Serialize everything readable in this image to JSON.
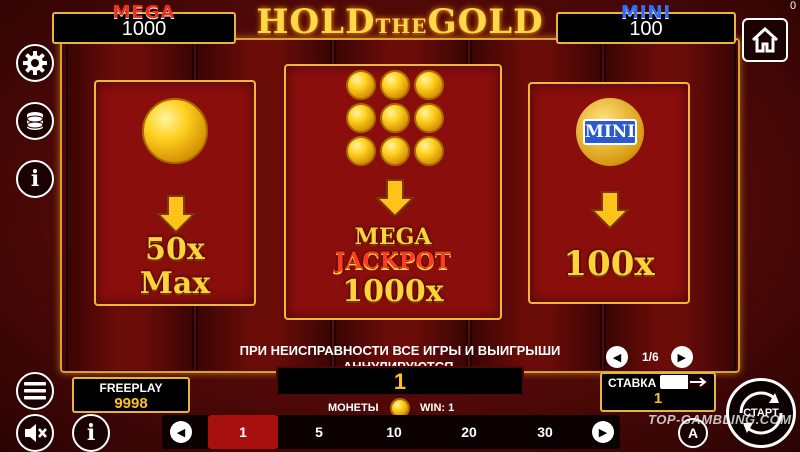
{
  "header": {
    "mega_label": "MEGA",
    "mega_value": "1000",
    "logo_hold": "HOLD",
    "logo_the": "THE",
    "logo_gold": "GOLD",
    "mini_label": "MINI",
    "mini_value": "100",
    "corner_value": "0"
  },
  "panels": {
    "left": {
      "line1": "50x",
      "line2": "Max"
    },
    "center": {
      "line1": "MEGA",
      "line2": "JACKPOT",
      "line3": "1000x"
    },
    "right": {
      "badge": "MINI",
      "line1": "100x"
    }
  },
  "notice": {
    "line1": "ПРИ НЕИСПРАВНОСТИ ВСЕ ИГРЫ И ВЫИГРЫШИ",
    "line2": "АННУЛИРУЮТСЯ."
  },
  "pager": {
    "label": "1/6"
  },
  "win": {
    "value": "1"
  },
  "coins_label": "МОНЕТЫ",
  "win_label": "WIN: 1",
  "freeplay": {
    "label": "FREEPLAY",
    "value": "9998"
  },
  "stake": {
    "label": "СТАВКА",
    "value": "1"
  },
  "bets": [
    "1",
    "5",
    "10",
    "20",
    "30"
  ],
  "start_label": "СТАРТ",
  "auto_label": "A",
  "watermark": "TOP-GAMBLING.COM",
  "colors": {
    "gold": "#ffd23a",
    "panel": "#8a0e0c",
    "mega": "#e83020",
    "mini": "#2a6aff"
  },
  "icons": [
    "home-icon",
    "gear-icon",
    "coin-stack-icon",
    "info-icon",
    "menu-icon",
    "sound-off-icon",
    "arrow-left-icon",
    "arrow-right-icon",
    "arrow-down-icon"
  ]
}
